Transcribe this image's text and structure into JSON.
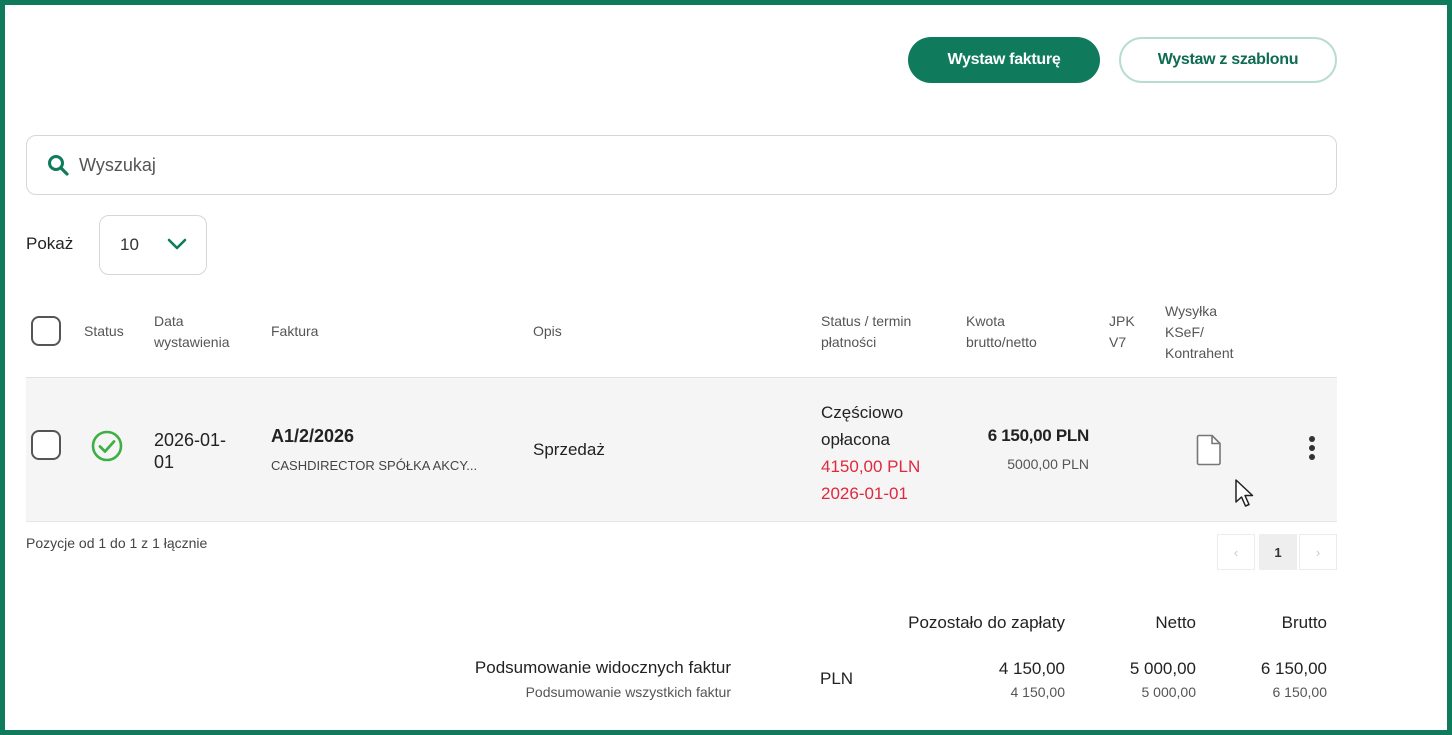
{
  "toolbar": {
    "issue_invoice_label": "Wystaw fakturę",
    "from_template_label": "Wystaw z szablonu"
  },
  "search": {
    "placeholder": "Wyszukaj",
    "value": ""
  },
  "page_size": {
    "label": "Pokaż",
    "value": "10"
  },
  "table": {
    "headers": {
      "status": "Status",
      "date_line1": "Data",
      "date_line2": "wystawienia",
      "invoice": "Faktura",
      "description": "Opis",
      "status_due_line1": "Status / termin",
      "status_due_line2": "płatności",
      "amount_line1": "Kwota",
      "amount_line2": "brutto/netto",
      "jpk_line1": "JPK",
      "jpk_line2": "V7",
      "ksef_line1": "Wysyłka",
      "ksef_line2": "KSeF/",
      "ksef_line3": "Kontrahent"
    },
    "rows": [
      {
        "status_icon": "check-circle-icon",
        "date_line1": "2026-01-",
        "date_line2": "01",
        "invoice_number": "A1/2/2026",
        "contractor": "CASHDIRECTOR SPÓŁKA AKCY...",
        "description": "Sprzedaż",
        "payment_status_line1": "Częściowo",
        "payment_status_line2": "opłacona",
        "remaining_amount": "4150,00 PLN",
        "due_date": "2026-01-01",
        "gross": "6 150,00 PLN",
        "net": "5000,00 PLN"
      }
    ]
  },
  "pagination": {
    "summary": "Pozycje od 1 do 1 z 1 łącznie",
    "prev": "‹",
    "current_page": "1",
    "next": "›"
  },
  "totals": {
    "headers": {
      "remaining": "Pozostało do zapłaty",
      "net": "Netto",
      "gross": "Brutto"
    },
    "visible_label": "Podsumowanie widocznych faktur",
    "all_label": "Podsumowanie wszystkich faktur",
    "currency": "PLN",
    "visible": {
      "remaining": "4 150,00",
      "net": "5 000,00",
      "gross": "6 150,00"
    },
    "all": {
      "remaining": "4 150,00",
      "net": "5 000,00",
      "gross": "6 150,00"
    }
  },
  "colors": {
    "accent": "#0f7a5c",
    "success": "#3cb043",
    "danger": "#e0283e"
  }
}
